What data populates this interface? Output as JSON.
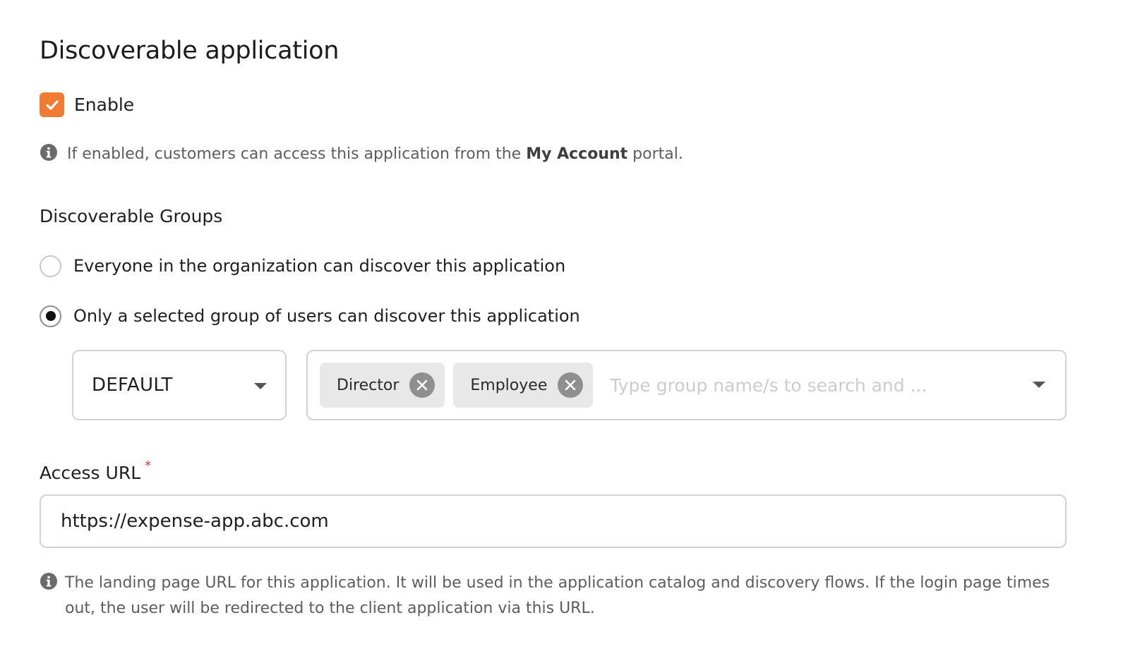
{
  "section": {
    "title": "Discoverable application"
  },
  "enable_checkbox": {
    "label": "Enable",
    "checked": true,
    "color": "#f07b33"
  },
  "enable_hint": {
    "before": "If enabled, customers can access this application from the ",
    "bold": "My Account",
    "after": " portal."
  },
  "discoverable_groups": {
    "heading": "Discoverable Groups",
    "options": [
      {
        "label": "Everyone in the organization can discover this application",
        "selected": false
      },
      {
        "label": "Only a selected group of users can discover this application",
        "selected": true
      }
    ]
  },
  "userstore_select": {
    "value": "DEFAULT"
  },
  "group_select": {
    "chips": [
      {
        "label": "Director"
      },
      {
        "label": "Employee"
      }
    ],
    "placeholder": "Type group name/s to search and ..."
  },
  "access_url": {
    "label": "Access URL",
    "required_mark": "*",
    "value": "https://expense-app.abc.com",
    "hint": "The landing page URL for this application. It will be used in the application catalog and discovery flows. If the login page times out, the user will be redirected to the client application via this URL."
  },
  "icons": {
    "info": "info-icon",
    "check": "check-icon",
    "remove": "close-icon",
    "dropdown": "chevron-down-icon"
  }
}
